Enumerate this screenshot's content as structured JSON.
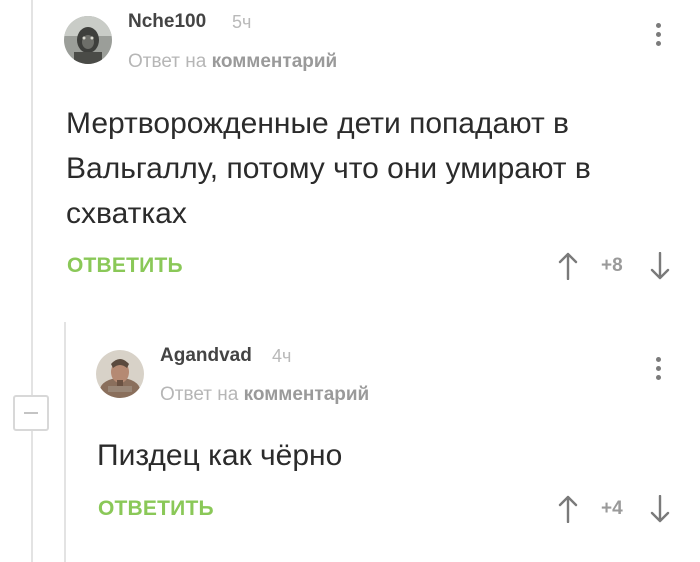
{
  "comments": [
    {
      "username": "Nche100",
      "time": "5ч",
      "reply_prefix": "Ответ на",
      "reply_link": "комментарий",
      "text": "Мертворожденные дети попадают в Вальгаллу, потому что они умирают в схватках",
      "reply_button": "ОТВЕТИТЬ",
      "rating": "+8"
    },
    {
      "username": "Agandvad",
      "time": "4ч",
      "reply_prefix": "Ответ на",
      "reply_link": "комментарий",
      "text": "Пиздец как чёрно",
      "reply_button": "ОТВЕТИТЬ",
      "rating": "+4"
    }
  ],
  "colors": {
    "reply_button": "#8ac858",
    "thread_line": "#e3e3e3"
  },
  "icons": [
    "kebab-menu-icon",
    "upvote-arrow-icon",
    "downvote-arrow-icon",
    "collapse-minus-icon"
  ]
}
